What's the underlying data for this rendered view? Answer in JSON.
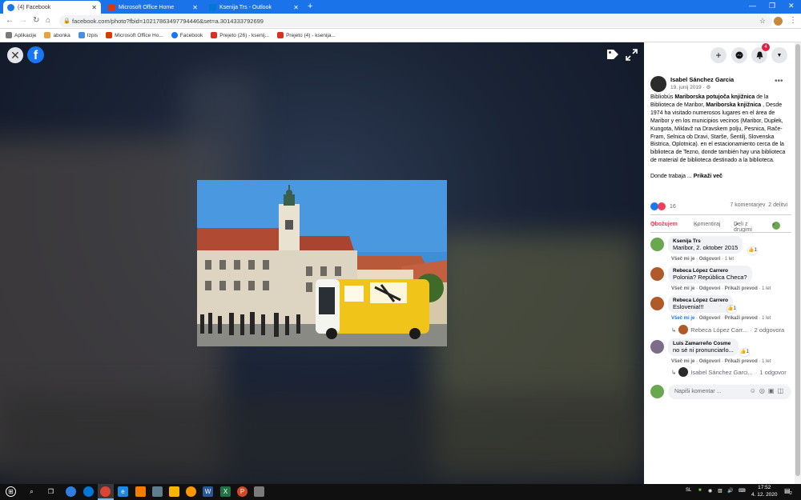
{
  "browser": {
    "tabs": [
      {
        "label": "(4) Facebook",
        "color": "#1877f2"
      },
      {
        "label": "Microsoft Office Home",
        "color": "#d83b01"
      },
      {
        "label": "Ksenija Trs - Outlook",
        "color": "#0078d4"
      }
    ],
    "new_tab": "+",
    "url": "facebook.com/photo?fbid=10217863497794446&set=a.3014333792699",
    "bookmarks": [
      {
        "label": "Aplikacije",
        "color": "#7a7a7a"
      },
      {
        "label": "abonka",
        "color": "#e8a33d"
      },
      {
        "label": "Izpis",
        "color": "#4a90e2"
      },
      {
        "label": "Microsoft Office Ho...",
        "color": "#d83b01"
      },
      {
        "label": "Facebook",
        "color": "#1877f2"
      },
      {
        "label": "Prejeto (26) - ksenij...",
        "color": "#d93025"
      },
      {
        "label": "Prejeto (4) - ksenija...",
        "color": "#d93025"
      }
    ]
  },
  "post": {
    "author": "Isabel Sánchez Garcia",
    "date": "19. junij 2019 · ⚙",
    "text_parts": [
      {
        "t": "Bibliobús ",
        "b": false
      },
      {
        "t": "Mariborska potujoča knjižnica",
        "b": true
      },
      {
        "t": " de la Biblioteca de Maribor, ",
        "b": false
      },
      {
        "t": "Mariborska knjižnica",
        "b": true
      },
      {
        "t": " , Desde 1974 ha visitado numerosos lugares en el área de Maribor y en los municipios vecinos (Maribor, Duplek, Kungota, Miklavž na Dravskem polju, Pesnica, Rače-Fram, Selnica ob Dravi, Starše, Šentilj, Slovenska Bistrica, Oplotnica). en el estacionamiento cerca de la biblioteca de Tezno, donde también hay una biblioteca de material de biblioteca destinado a la biblioteca.",
        "b": false
      }
    ],
    "text_tail": "Donde trabaja ... ",
    "see_more": "Prikaži več",
    "reactions_count": "16",
    "comments_count": "7 komentarjev",
    "shares_count": "2 delitvi",
    "action_love": "Obožujem",
    "action_comment": "Komentiraj",
    "action_share": "Deli z drugimi",
    "notifications_badge": "4"
  },
  "comments": [
    {
      "name": "Ksenija Trs",
      "text": "Maribor, 2. oktober 2015",
      "meta_like": "Všeč mi je",
      "meta_reply": "Odgovori",
      "meta_translate": "",
      "time": "1 let",
      "likes": "1",
      "avatar": "#6aa84f"
    },
    {
      "name": "Rebeca López Carrero",
      "text": "Polonia? República Checa?",
      "meta_like": "Všeč mi je",
      "meta_reply": "Odgovori",
      "meta_translate": "Prikaži prevod",
      "time": "1 let",
      "likes": "",
      "avatar": "#b05a2a"
    },
    {
      "name": "Rebeca López Carrero",
      "text": "Eslovenia!!!",
      "meta_like": "Všeč mi je",
      "meta_reply": "Odgovori",
      "meta_translate": "Prikaži prevod",
      "time": "1 let",
      "likes": "1",
      "avatar": "#b05a2a"
    },
    {
      "name": "Luis Zamarreño Cosme",
      "text": "no sé ni pronunciarlo...",
      "meta_like": "Všeč mi je",
      "meta_reply": "Odgovori",
      "meta_translate": "Prikaži prevod",
      "time": "1 let",
      "likes": "1",
      "avatar": "#7d6b8a"
    }
  ],
  "replies": [
    {
      "name": "Rebeca López Carr...",
      "count": "2 odgovora"
    },
    {
      "name": "Isabel Sánchez Garci...",
      "count": "1 odgovor"
    }
  ],
  "write_placeholder": "Napiši komentar ...",
  "taskbar": {
    "lang": "SL",
    "time": "17:52",
    "date": "4. 12. 2020",
    "notif_count": "2"
  }
}
